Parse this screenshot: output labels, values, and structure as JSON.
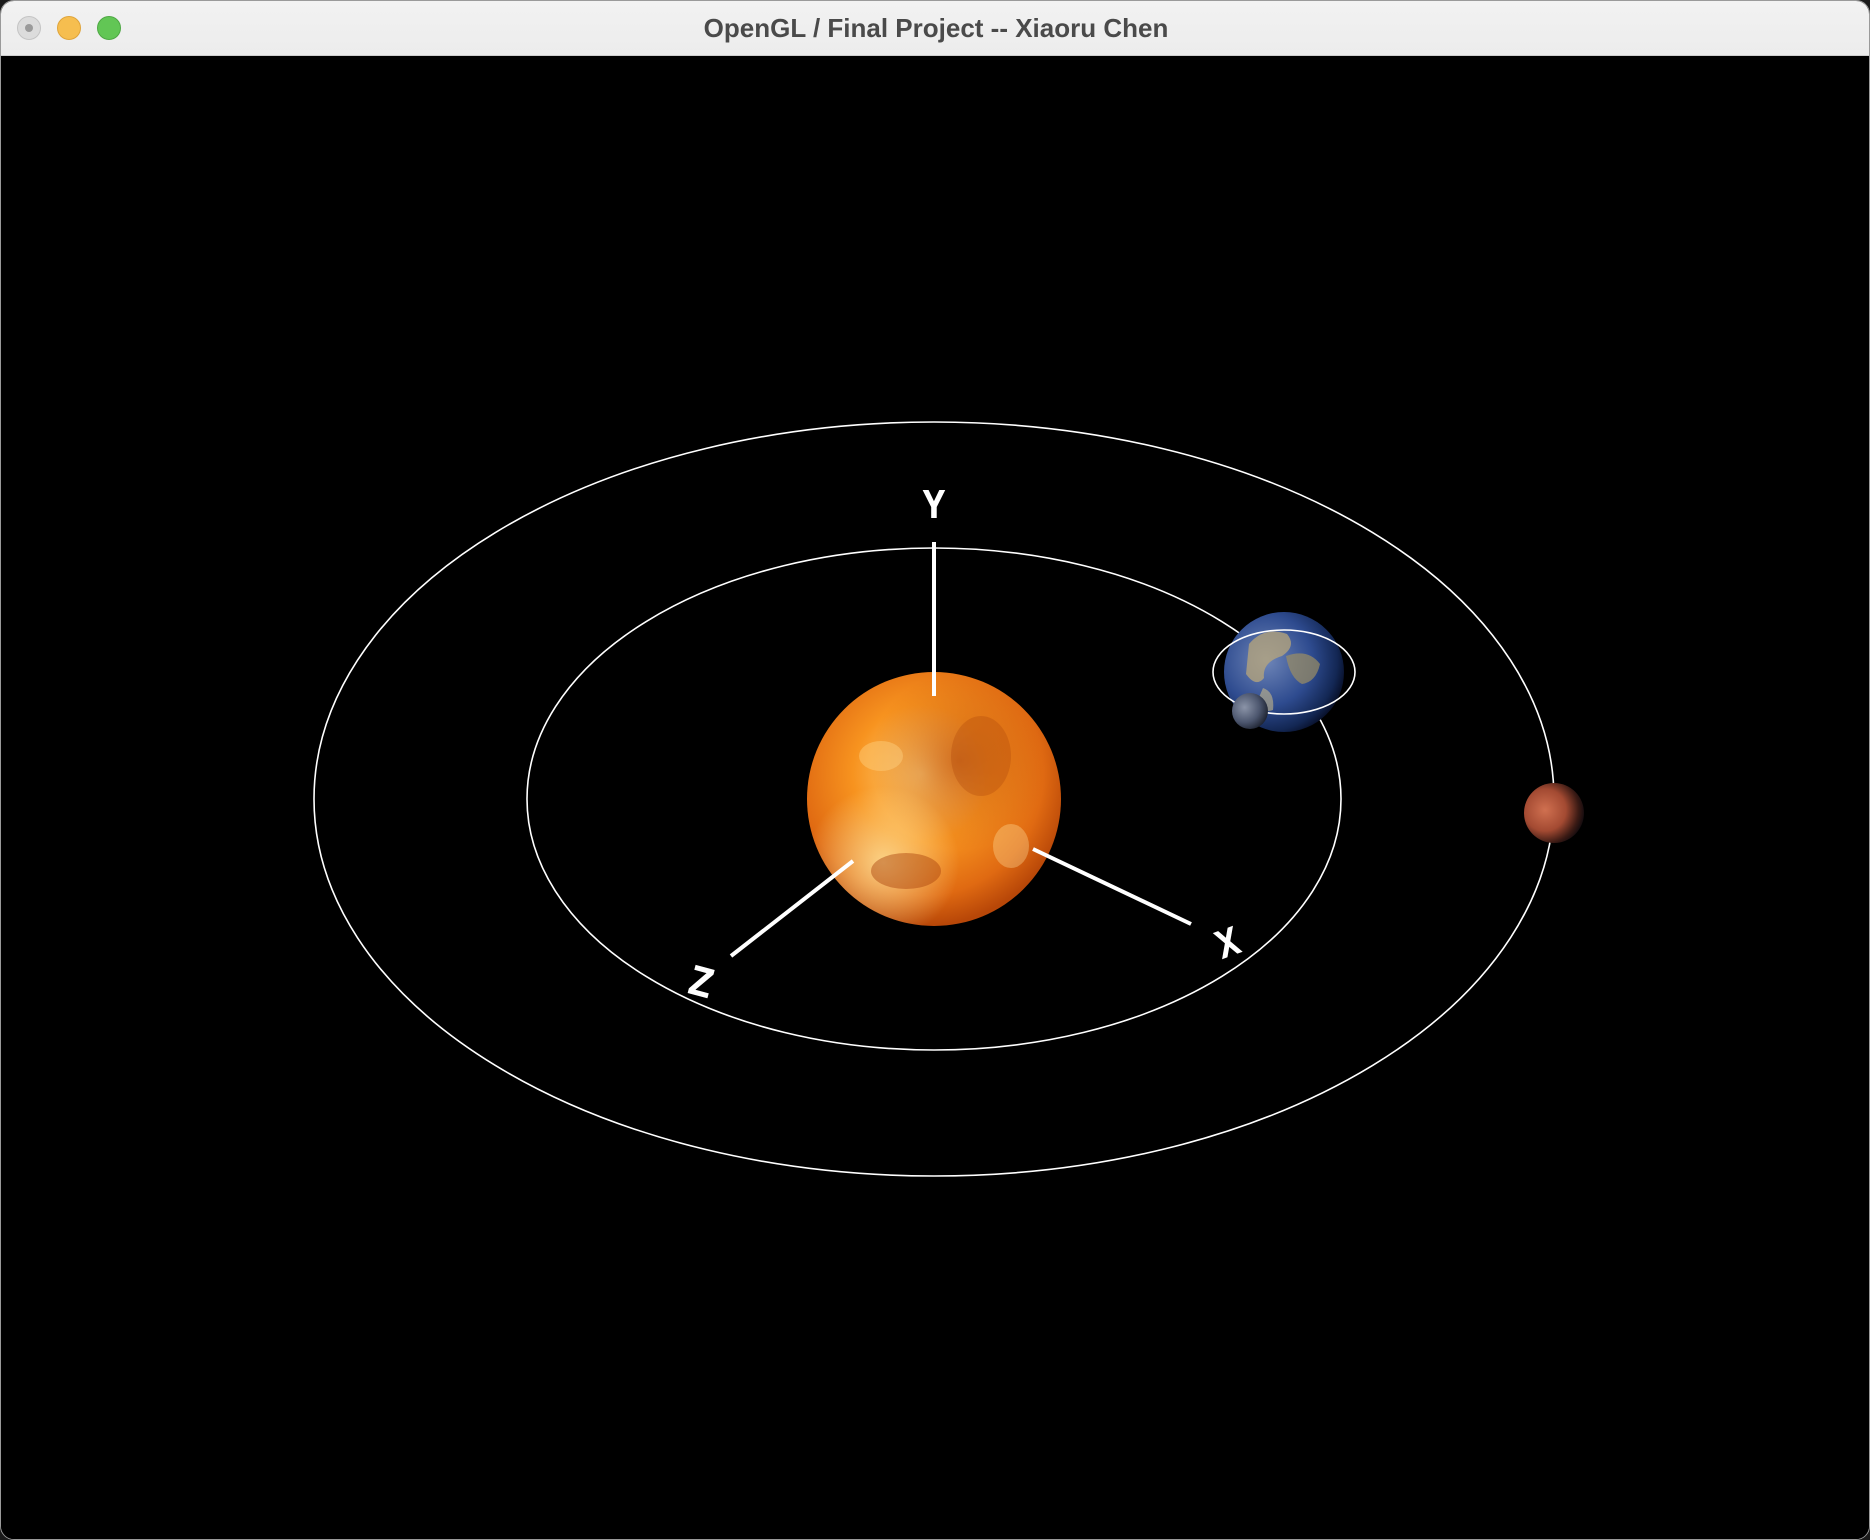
{
  "window": {
    "title": "OpenGL / Final Project -- Xiaoru Chen"
  },
  "scene": {
    "background_color": "#000000",
    "orbit_color": "#ffffff",
    "axis_color": "#ffffff",
    "axes": {
      "x_label": "X",
      "y_label": "Y",
      "z_label": "Z"
    },
    "bodies": {
      "sun": "sun-sphere",
      "earth": "earth-sphere",
      "moon": "moon-sphere",
      "mars": "mars-sphere"
    },
    "colors": {
      "sun_core": "#ffb13b",
      "sun_edge": "#d9540d",
      "earth_ocean": "#2f4f9a",
      "earth_land": "#b9a77a",
      "mars": "#b4503a"
    }
  }
}
